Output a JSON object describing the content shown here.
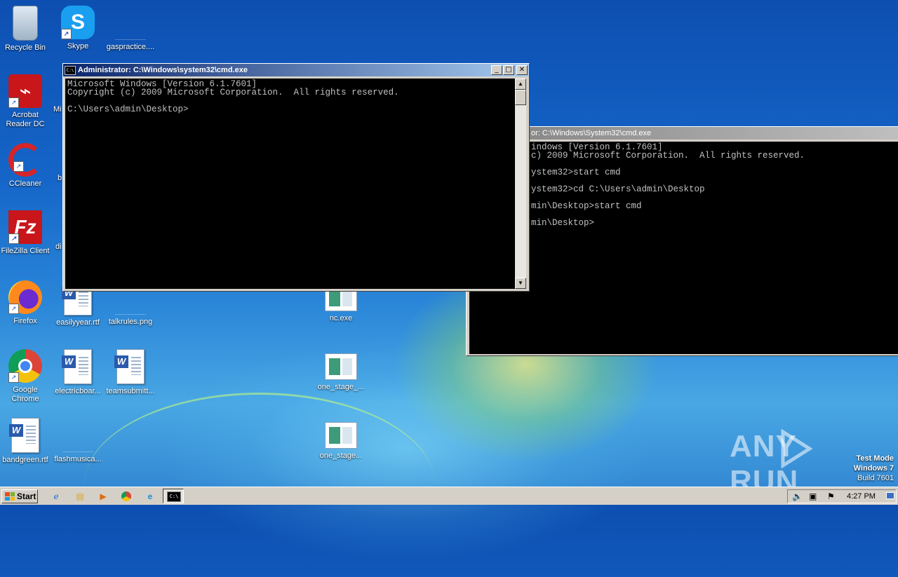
{
  "desktop": {
    "icons": [
      {
        "label": "Recycle Bin",
        "icon": "recycle-bin-icon"
      },
      {
        "label": "Skype",
        "icon": "skype-icon"
      },
      {
        "label": "gaspractice....",
        "icon": "file-icon"
      },
      {
        "label": "Acrobat Reader DC",
        "icon": "acrobat-icon"
      },
      {
        "label": "Mi",
        "icon": "file-icon"
      },
      {
        "label": "CCleaner",
        "icon": "ccleaner-icon"
      },
      {
        "label": "b",
        "icon": "file-icon"
      },
      {
        "label": "FileZilla Client",
        "icon": "filezilla-icon"
      },
      {
        "label": "di",
        "icon": "file-icon"
      },
      {
        "label": "Firefox",
        "icon": "firefox-icon"
      },
      {
        "label": "easilyyear.rtf",
        "icon": "word-doc-icon"
      },
      {
        "label": "talkrules.png",
        "icon": "image-file-icon"
      },
      {
        "label": "nc.exe",
        "icon": "exe-icon"
      },
      {
        "label": "Google Chrome",
        "icon": "chrome-icon"
      },
      {
        "label": "electricboar...",
        "icon": "word-doc-icon"
      },
      {
        "label": "teamsubmitt...",
        "icon": "word-doc-icon"
      },
      {
        "label": "one_stage_...",
        "icon": "exe-icon"
      },
      {
        "label": "bandgreen.rtf",
        "icon": "word-doc-icon"
      },
      {
        "label": "flashmusica...",
        "icon": "file-icon"
      },
      {
        "label": "one_stage...",
        "icon": "exe-icon"
      }
    ]
  },
  "cmd_window_front": {
    "title": "Administrator: C:\\Windows\\system32\\cmd.exe",
    "lines": [
      "Microsoft Windows [Version 6.1.7601]",
      "Copyright (c) 2009 Microsoft Corporation.  All rights reserved.",
      "",
      "C:\\Users\\admin\\Desktop>"
    ]
  },
  "cmd_window_back": {
    "title": "or: C:\\Windows\\System32\\cmd.exe",
    "lines": [
      "indows [Version 6.1.7601]",
      "c) 2009 Microsoft Corporation.  All rights reserved.",
      "",
      "ystem32>start cmd",
      "",
      "ystem32>cd C:\\Users\\admin\\Desktop",
      "",
      "min\\Desktop>start cmd",
      "",
      "min\\Desktop>"
    ]
  },
  "window_buttons": {
    "minimize": "_",
    "maximize": "□",
    "close": "✕"
  },
  "watermark": {
    "left": "ANY",
    "right": "RUN"
  },
  "test_mode": {
    "line1": "Test Mode",
    "line2": "Windows 7",
    "line3": "Build 7601"
  },
  "taskbar": {
    "start_label": "Start",
    "clock": "4:27 PM",
    "quick_launch": [
      "ie-icon",
      "explorer-icon",
      "media-player-icon",
      "chrome-icon",
      "edge-icon"
    ],
    "tray": [
      "volume-icon",
      "network-icon",
      "flag-icon"
    ]
  },
  "colors": {
    "console_bg": "#000000",
    "console_fg": "#c0c0c0",
    "active_title": "#0a246a",
    "inactive_title": "#808080"
  }
}
